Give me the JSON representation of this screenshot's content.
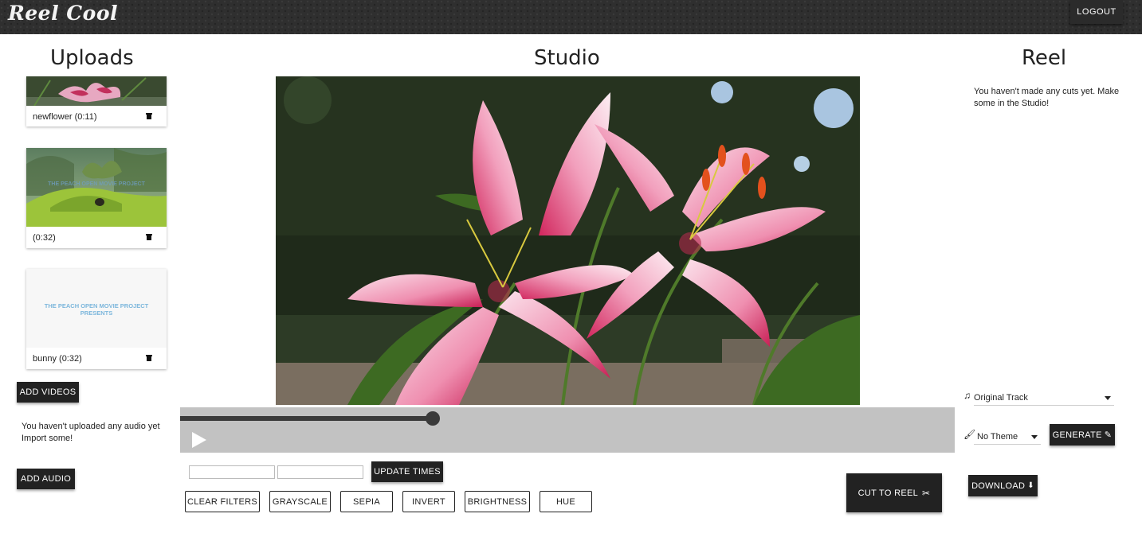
{
  "header": {
    "logo": "Reel Cool",
    "logout_label": "LOGOUT"
  },
  "uploads": {
    "title": "Uploads",
    "videos": [
      {
        "caption": "newflower (0:11)"
      },
      {
        "caption": "(0:32)",
        "thumb_text": "THE PEACH OPEN MOVIE PROJECT"
      },
      {
        "caption": "bunny (0:32)",
        "thumb_text": "THE PEACH OPEN MOVIE PROJECT PRESENTS"
      }
    ],
    "add_videos_label": "ADD VIDEOS",
    "audio_empty_text": "You haven't uploaded any audio yet Import some!",
    "add_audio_label": "ADD AUDIO"
  },
  "studio": {
    "title": "Studio",
    "playback_progress": 0.326,
    "start_time_value": "",
    "end_time_value": "",
    "update_times_label": "UPDATE TIMES",
    "filters": [
      "CLEAR FILTERS",
      "GRAYSCALE",
      "SEPIA",
      "INVERT",
      "BRIGHTNESS",
      "HUE"
    ],
    "cut_to_reel_label": "CUT TO REEL"
  },
  "reel": {
    "title": "Reel",
    "empty_text": "You haven't made any cuts yet. Make some in the Studio!",
    "track_select": "Original Track",
    "theme_select": "No Theme",
    "generate_label": "GENERATE",
    "download_label": "DOWNLOAD"
  },
  "colors": {
    "topbar": "#2f2f2f",
    "button_dark": "#222222",
    "scrubber_bg": "#c2c2c2",
    "thumb_text": "#7db7dc"
  }
}
